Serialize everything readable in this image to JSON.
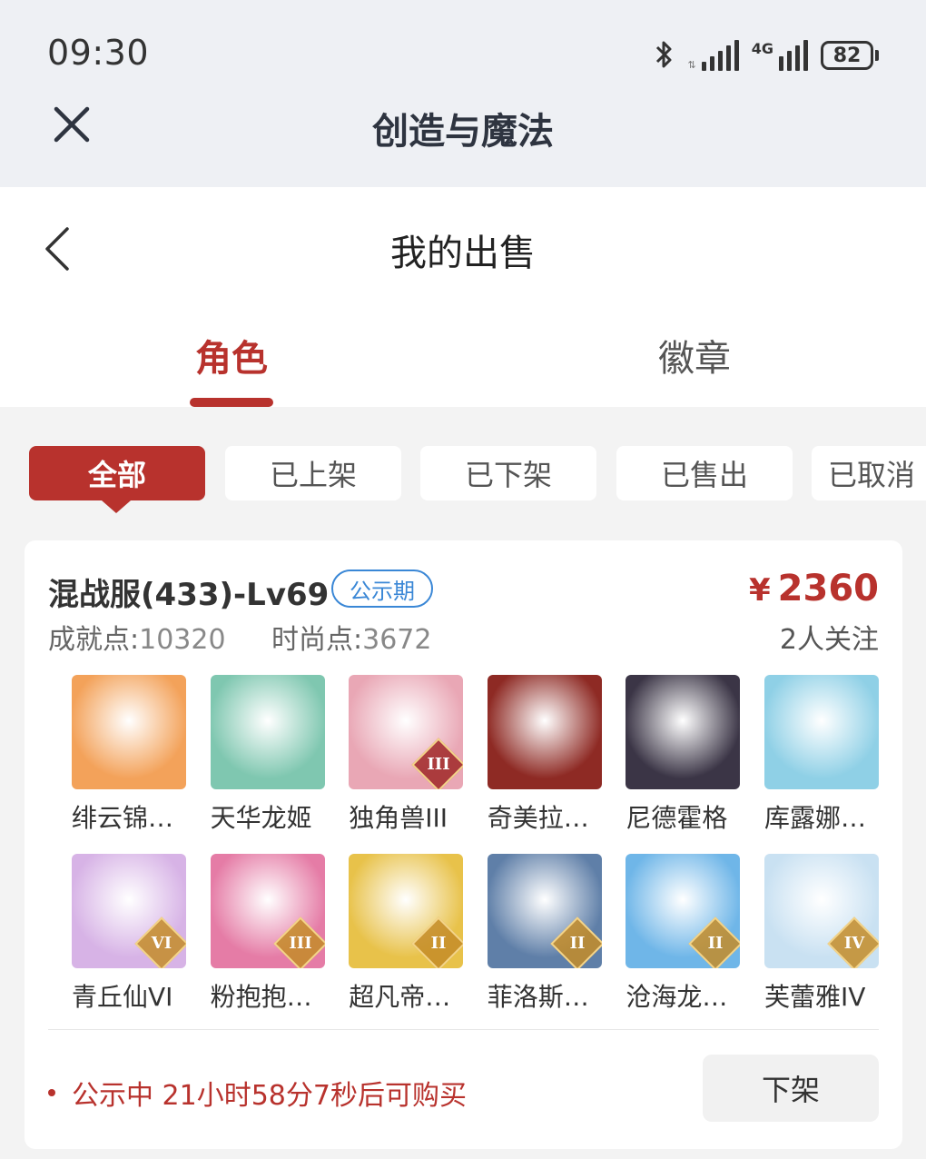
{
  "status_bar": {
    "time": "09:30",
    "network_tag": "4G",
    "battery": "82"
  },
  "app_header": {
    "title": "创造与魔法",
    "close_icon": "close-icon"
  },
  "page_header": {
    "title": "我的出售",
    "back_icon": "chevron-left-icon"
  },
  "tabs": [
    {
      "label": "角色",
      "active": true
    },
    {
      "label": "徽章",
      "active": false
    }
  ],
  "filters": [
    {
      "label": "全部",
      "active": true
    },
    {
      "label": "已上架",
      "active": false
    },
    {
      "label": "已下架",
      "active": false
    },
    {
      "label": "已售出",
      "active": false
    },
    {
      "label": "已取消",
      "active": false
    }
  ],
  "listing": {
    "server": "混战服(433)-Lv69",
    "period_badge": "公示期",
    "price_symbol": "¥",
    "price": "2360",
    "achievement_label": "成就点:",
    "achievement_value": "10320",
    "fashion_label": "时尚点:",
    "fashion_value": "3672",
    "followers": "2人关注",
    "roles": [
      {
        "name": "绯云锦…",
        "tier": "",
        "color": "#f3a25a"
      },
      {
        "name": "天华龙姬",
        "tier": "",
        "color": "#7fc7b0"
      },
      {
        "name": "独角兽III",
        "tier": "III",
        "color": "#e9a7b5"
      },
      {
        "name": "奇美拉…",
        "tier": "",
        "color": "#8e2a24"
      },
      {
        "name": "尼德霍格",
        "tier": "",
        "color": "#3b3546"
      },
      {
        "name": "库露娜…",
        "tier": "",
        "color": "#8fd0e6"
      },
      {
        "name": "青丘仙VI",
        "tier": "VI",
        "color": "#d7b3e6"
      },
      {
        "name": "粉抱抱…",
        "tier": "III",
        "color": "#e57ca6"
      },
      {
        "name": "超凡帝…",
        "tier": "II",
        "color": "#e8c24a"
      },
      {
        "name": "菲洛斯…",
        "tier": "II",
        "color": "#5f7fa8"
      },
      {
        "name": "沧海龙…",
        "tier": "II",
        "color": "#6fb6e8"
      },
      {
        "name": "芙蕾雅IV",
        "tier": "IV",
        "color": "#c9e1f2"
      }
    ],
    "notice": "公示中 21小时58分7秒后可购买",
    "delist_button": "下架"
  },
  "colors": {
    "accent": "#b8322d",
    "badge_blue": "#3a87d6"
  }
}
